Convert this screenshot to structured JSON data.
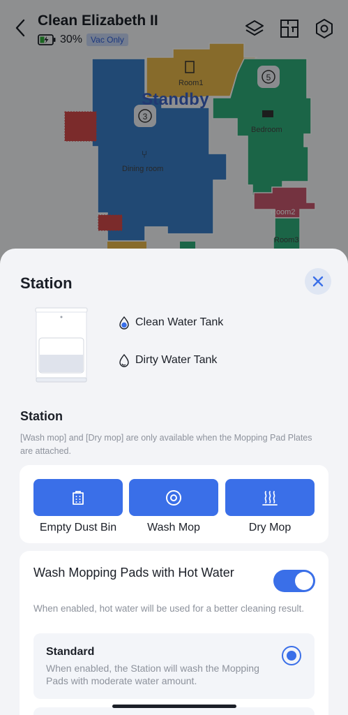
{
  "header": {
    "title": "Clean Elizabeth II",
    "battery_pct": "30%",
    "mode_badge": "Vac Only",
    "icons": [
      "back-chevron-icon",
      "layers-icon",
      "room-layout-icon",
      "settings-hexagon-icon"
    ]
  },
  "map": {
    "status": "Standby",
    "rooms": [
      {
        "name": "Room1",
        "color": "#e8b94a"
      },
      {
        "name": "Bedroom",
        "color": "#2fae7a",
        "order": "5"
      },
      {
        "name": "Dining room",
        "color": "#3a7fc8",
        "order": "3"
      },
      {
        "name": "Room2",
        "color": "#c9586f"
      },
      {
        "name": "Room3",
        "color": "#2fae7a"
      }
    ]
  },
  "sheet": {
    "title": "Station",
    "tanks": [
      {
        "label": "Clean Water Tank",
        "icon": "water-drop-filled-icon"
      },
      {
        "label": "Dirty Water Tank",
        "icon": "water-drop-outline-icon"
      }
    ],
    "section_title": "Station",
    "section_note": "[Wash mop] and [Dry mop] are only available when the Mopping Pad Plates are attached.",
    "actions": [
      {
        "label": "Empty Dust Bin",
        "icon": "dust-bin-icon"
      },
      {
        "label": "Wash Mop",
        "icon": "wash-mop-icon"
      },
      {
        "label": "Dry Mop",
        "icon": "dry-heat-icon"
      }
    ],
    "hot_water": {
      "title": "Wash Mopping Pads with Hot Water",
      "enabled": true,
      "description": "When enabled, hot water will be used for a better cleaning result.",
      "options": [
        {
          "title": "Standard",
          "description": "When enabled, the Station will wash the Mopping Pads with moderate water amount.",
          "selected": true
        }
      ]
    }
  },
  "colors": {
    "accent": "#3a6fe8",
    "sheet_bg": "#f3f4f7",
    "muted_text": "#8d929c"
  }
}
